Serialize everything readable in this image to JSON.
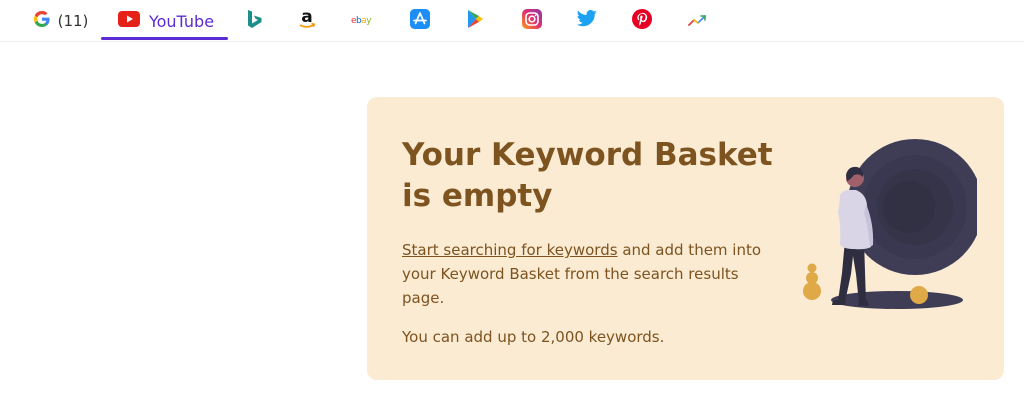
{
  "tabs": [
    {
      "name": "google",
      "count": "(11)"
    },
    {
      "name": "youtube",
      "label": "YouTube",
      "active": true
    },
    {
      "name": "bing"
    },
    {
      "name": "amazon"
    },
    {
      "name": "ebay",
      "icon_text": "ebay"
    },
    {
      "name": "app-store"
    },
    {
      "name": "play-store"
    },
    {
      "name": "instagram"
    },
    {
      "name": "twitter"
    },
    {
      "name": "pinterest"
    },
    {
      "name": "trends"
    }
  ],
  "colors": {
    "accent": "#5b2bd3",
    "card_bg": "#faebd2",
    "card_text": "#7d5320"
  },
  "basket": {
    "title": "Your Keyword Basket is empty",
    "link_text": "Start searching for keywords",
    "body_rest": " and add them into your Keyword Basket from the search results page.",
    "limit_text": "You can add up to 2,000 keywords."
  }
}
